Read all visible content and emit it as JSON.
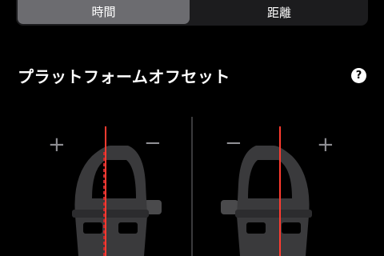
{
  "tabs": [
    {
      "label": "時間",
      "selected": true
    },
    {
      "label": "距離",
      "selected": false
    }
  ],
  "section": {
    "title": "プラットフォームオフセット",
    "help_icon": "question-mark-icon",
    "help_glyph": "?"
  },
  "left_pedal": {
    "plus": "+",
    "minus": "−"
  },
  "right_pedal": {
    "plus": "+",
    "minus": "−"
  },
  "colors": {
    "background": "#000000",
    "segment_bg": "#1c1c1e",
    "segment_selected": "#6c6c70",
    "pedal_body": "#3a3a3c",
    "center_line": "#c0282d",
    "offset_line": "#ff3b30"
  }
}
